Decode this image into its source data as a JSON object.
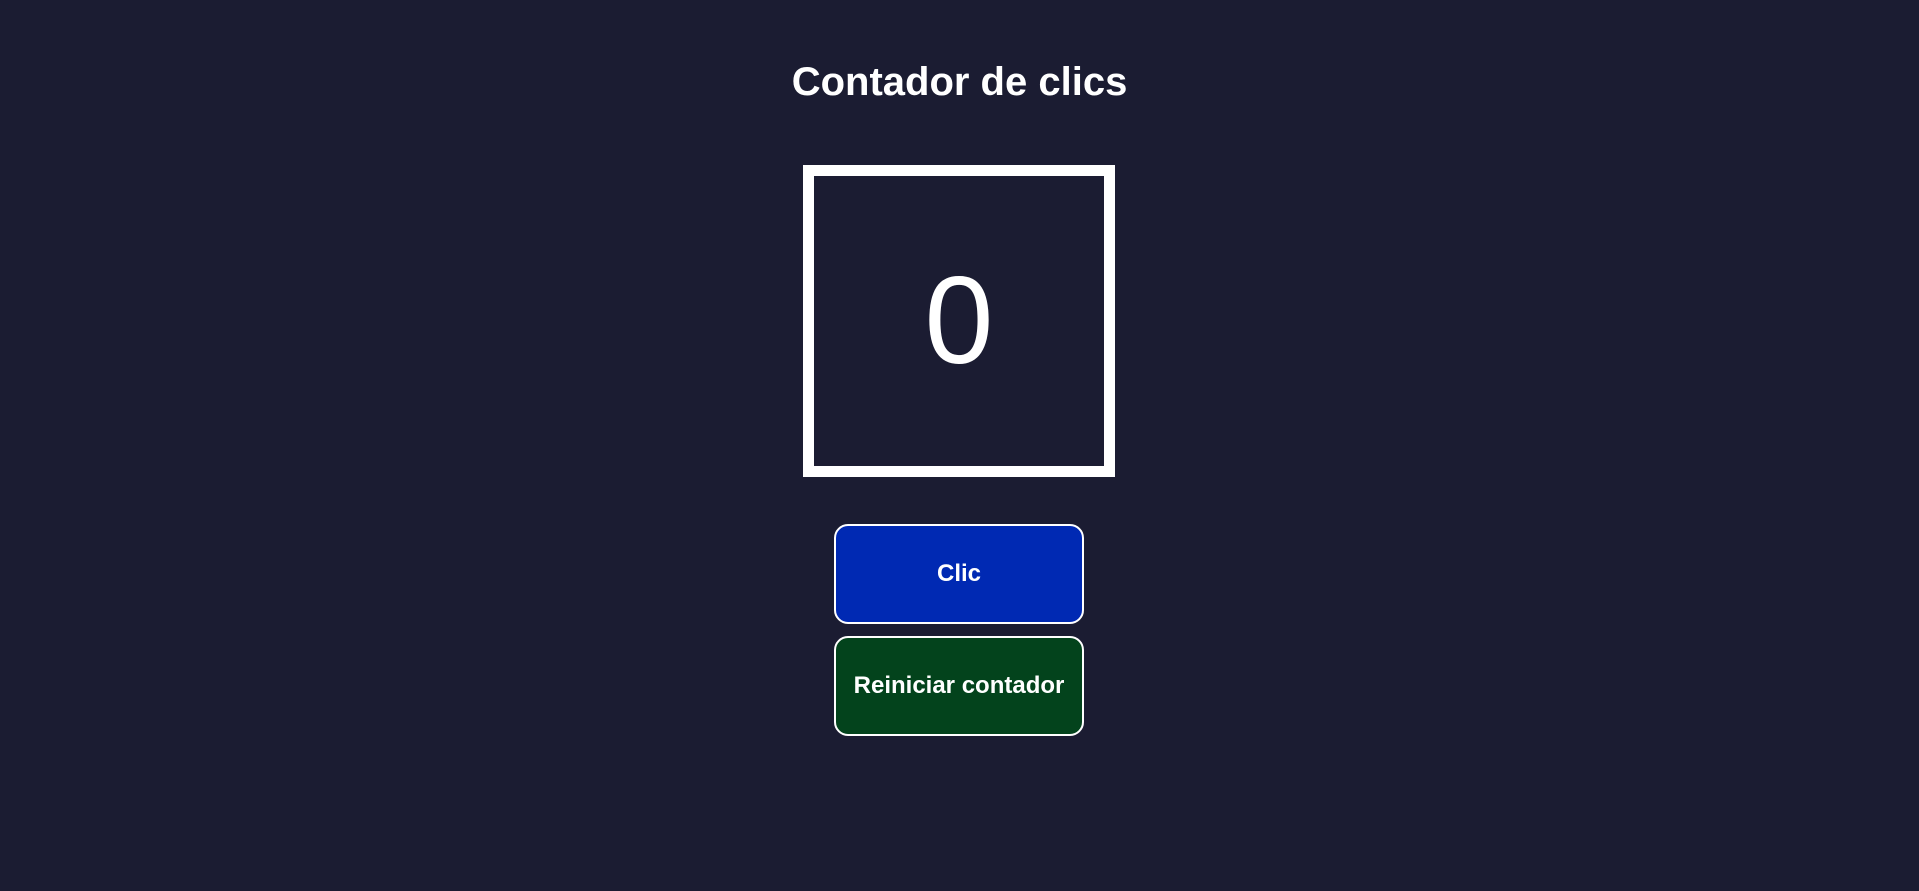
{
  "page": {
    "title": "Contador de clics"
  },
  "counter": {
    "value": "0"
  },
  "buttons": {
    "click_label": "Clic",
    "reset_label": "Reiniciar contador"
  },
  "colors": {
    "background": "#1b1c32",
    "click_button": "#0029b3",
    "reset_button": "#03431c",
    "text": "#ffffff"
  }
}
